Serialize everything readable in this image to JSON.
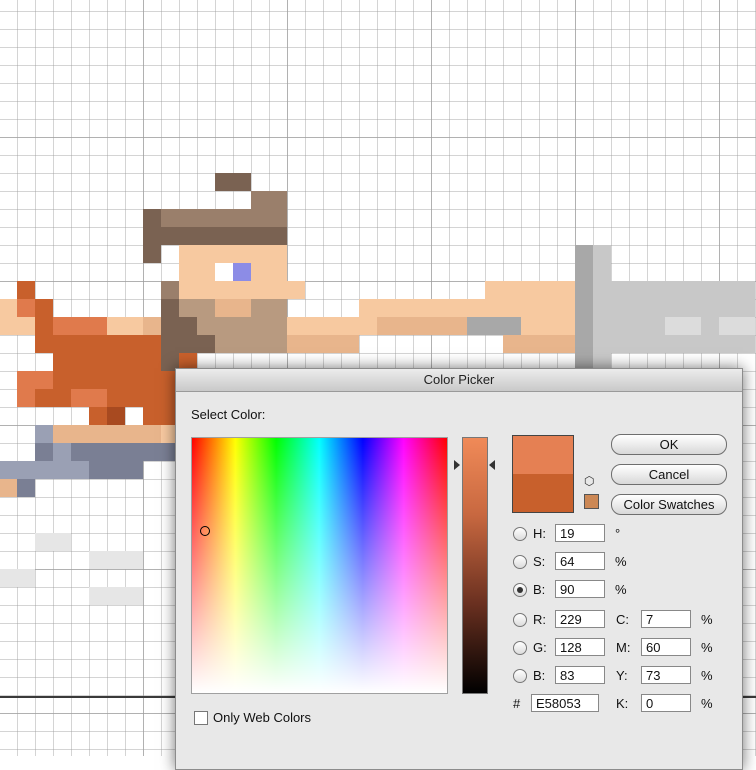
{
  "dialog": {
    "title": "Color Picker",
    "select_label": "Select Color:",
    "buttons": {
      "ok": "OK",
      "cancel": "Cancel",
      "swatches": "Color Swatches"
    },
    "new_color": "#e58053",
    "current_color": "#c8602c",
    "websafe_color": "#cc8855",
    "hsb": {
      "h": {
        "label": "H:",
        "value": "19",
        "unit": "°"
      },
      "s": {
        "label": "S:",
        "value": "64",
        "unit": "%"
      },
      "b": {
        "label": "B:",
        "value": "90",
        "unit": "%"
      }
    },
    "rgb": {
      "r": {
        "label": "R:",
        "value": "229"
      },
      "g": {
        "label": "G:",
        "value": "128"
      },
      "b": {
        "label": "B:",
        "value": "83"
      }
    },
    "cmyk": {
      "c": {
        "label": "C:",
        "value": "7",
        "unit": "%"
      },
      "m": {
        "label": "M:",
        "value": "60",
        "unit": "%"
      },
      "y": {
        "label": "Y:",
        "value": "73",
        "unit": "%"
      },
      "k": {
        "label": "K:",
        "value": "0",
        "unit": "%"
      }
    },
    "hex": {
      "label": "#",
      "value": "E58053"
    },
    "web_colors_label": "Only Web Colors",
    "selected_mode": "B"
  },
  "icons": {
    "cube": "cube-icon",
    "warning": "websafe-swatch"
  }
}
